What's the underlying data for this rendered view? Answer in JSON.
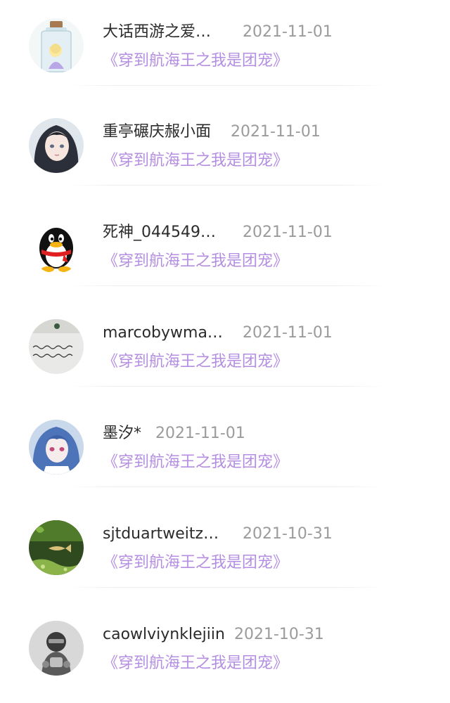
{
  "comments": [
    {
      "name": "大话西游之爱…",
      "date": "2021-11-01",
      "book": "《穿到航海王之我是团宠》",
      "avatar": "bottle-girl-avatar"
    },
    {
      "name": "重亭碾庆赧小面",
      "date": "2021-11-01",
      "book": "《穿到航海王之我是团宠》",
      "avatar": "anime-girl-avatar"
    },
    {
      "name": "死神_044549…",
      "date": "2021-11-01",
      "book": "《穿到航海王之我是团宠》",
      "avatar": "qq-penguin-avatar"
    },
    {
      "name": "marcobywma…",
      "date": "2021-11-01",
      "book": "《穿到航海王之我是团宠》",
      "avatar": "handwriting-avatar"
    },
    {
      "name": "墨汐*",
      "date": "2021-11-01",
      "book": "《穿到航海王之我是团宠》",
      "avatar": "blue-hair-girl-avatar"
    },
    {
      "name": "sjtduartweitz…",
      "date": "2021-10-31",
      "book": "《穿到航海王之我是团宠》",
      "avatar": "aquarium-fish-avatar"
    },
    {
      "name": "caowlviynklejiin",
      "date": "2021-10-31",
      "book": "《穿到航海王之我是团宠》",
      "avatar": "robot-avatar"
    }
  ],
  "colors": {
    "name": "#2b2b2b",
    "date": "#9b9b9b",
    "book": "#b48ee0"
  }
}
